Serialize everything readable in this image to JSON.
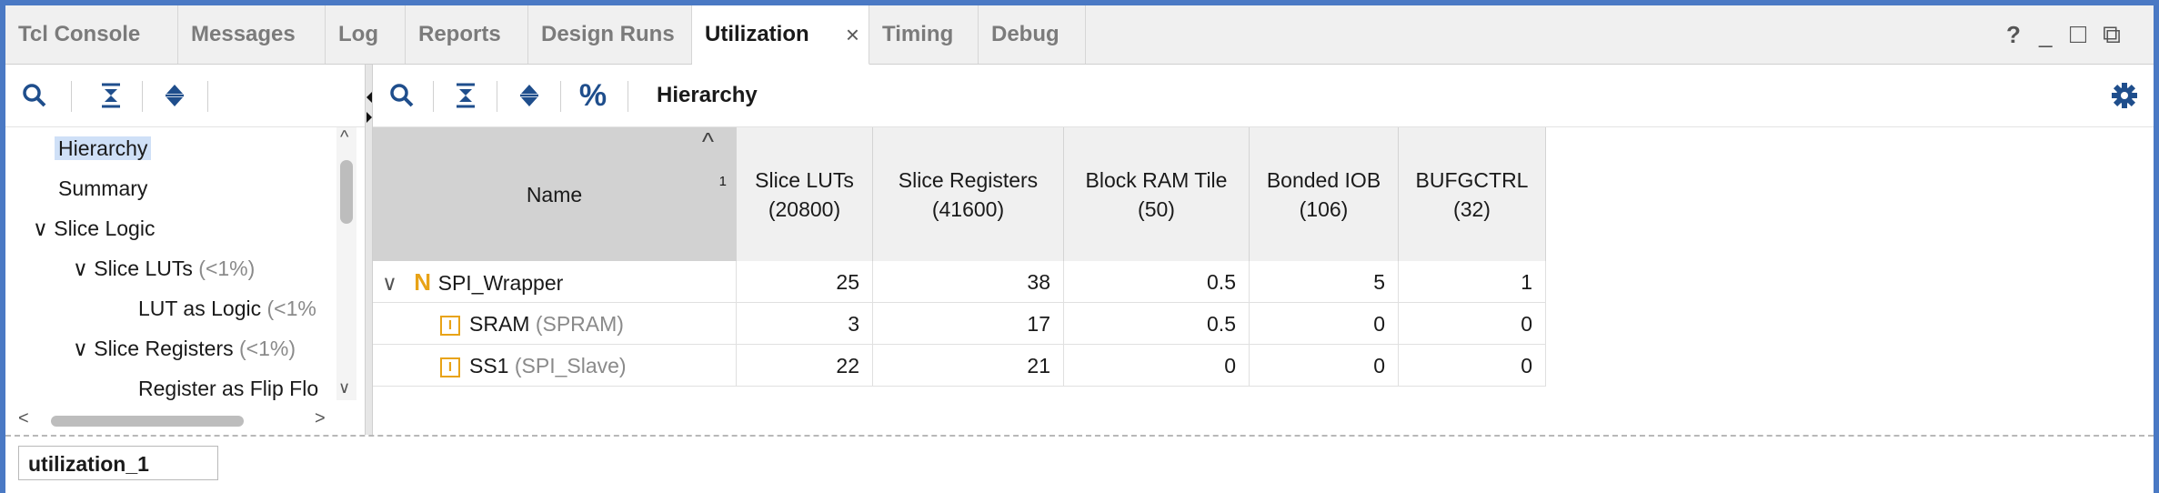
{
  "tabs": [
    {
      "label": "Tcl Console"
    },
    {
      "label": "Messages"
    },
    {
      "label": "Log"
    },
    {
      "label": "Reports"
    },
    {
      "label": "Design Runs"
    },
    {
      "label": "Utilization",
      "active": true,
      "close": "×"
    },
    {
      "label": "Timing"
    },
    {
      "label": "Debug"
    }
  ],
  "window_controls": {
    "help": "?",
    "minimize": "_",
    "maximize": "□",
    "restore": "⧉"
  },
  "toolbar": {
    "hierarchy_label": "Hierarchy",
    "percent_label": "%"
  },
  "tree": {
    "items": [
      {
        "label": "Hierarchy",
        "selected": true
      },
      {
        "label": "Summary"
      },
      {
        "label": "Slice Logic",
        "expander": "∨"
      },
      {
        "label": "Slice LUTs",
        "suffix": "(<1%)",
        "expander": "∨"
      },
      {
        "label": "LUT as Logic",
        "suffix": "(<1%"
      },
      {
        "label": "Slice Registers",
        "suffix": "(<1%)",
        "expander": "∨"
      },
      {
        "label": "Register as Flip Flo"
      }
    ],
    "scroll_up": "^",
    "scroll_down": "∨",
    "scroll_left": "<",
    "scroll_right": ">"
  },
  "table": {
    "columns": [
      {
        "label": "Name",
        "sort_index": "1",
        "sort_arrow": "^"
      },
      {
        "label": "Slice LUTs\n(20800)"
      },
      {
        "label": "Slice Registers\n(41600)"
      },
      {
        "label": "Block RAM Tile\n(50)"
      },
      {
        "label": "Bonded IOB\n(106)"
      },
      {
        "label": "BUFGCTRL\n(32)"
      }
    ],
    "rows": [
      {
        "expander": "∨",
        "icon": "N",
        "name": "SPI_Wrapper",
        "module": "",
        "values": [
          "25",
          "38",
          "0.5",
          "5",
          "1"
        ]
      },
      {
        "expander": "",
        "icon": "I",
        "name": "SRAM",
        "module": "(SPRAM)",
        "values": [
          "3",
          "17",
          "0.5",
          "0",
          "0"
        ]
      },
      {
        "expander": "",
        "icon": "I",
        "name": "SS1",
        "module": "(SPI_Slave)",
        "values": [
          "22",
          "21",
          "0",
          "0",
          "0"
        ]
      }
    ]
  },
  "bottom_tab": {
    "label": "utilization_1"
  },
  "colors": {
    "frame": "#4a79c4",
    "top_module_icon": "#e8a317",
    "instance_icon": "#e8a317",
    "selection": "#cfe0f7"
  }
}
